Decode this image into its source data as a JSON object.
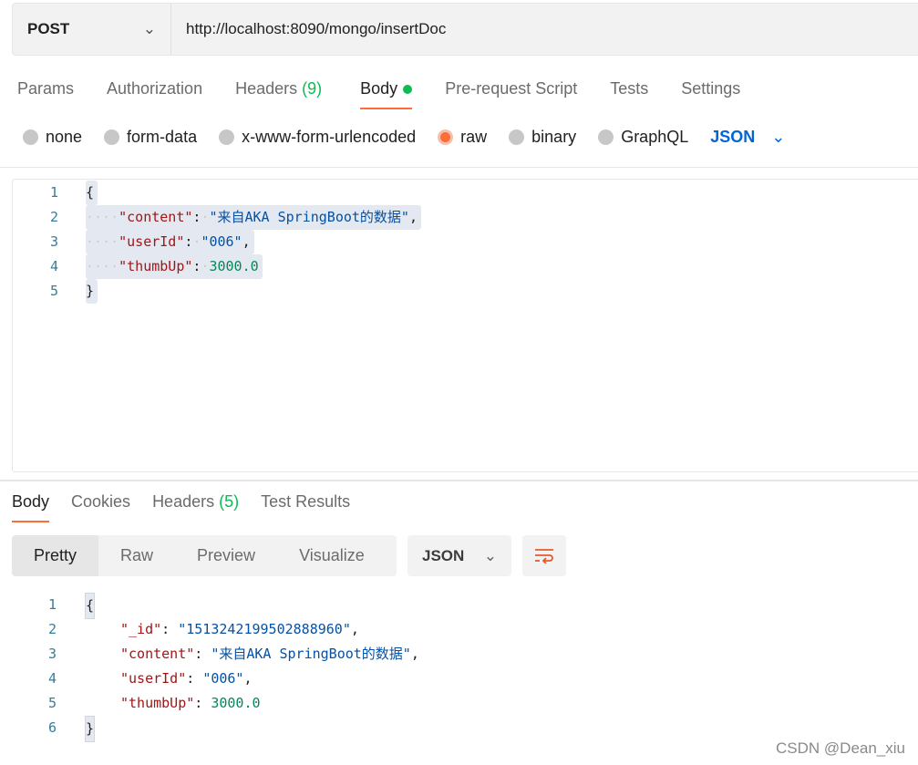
{
  "request": {
    "method": "POST",
    "url": "http://localhost:8090/mongo/insertDoc",
    "tabs": [
      {
        "label": "Params"
      },
      {
        "label": "Authorization"
      },
      {
        "label": "Headers",
        "count": "(9)"
      },
      {
        "label": "Body"
      },
      {
        "label": "Pre-request Script"
      },
      {
        "label": "Tests"
      },
      {
        "label": "Settings"
      }
    ],
    "body_types": [
      "none",
      "form-data",
      "x-www-form-urlencoded",
      "raw",
      "binary",
      "GraphQL"
    ],
    "selected_body_type": "raw",
    "format": "JSON",
    "code": [
      "{",
      "\"content\"",
      "\"来自AKA SpringBoot的数据\"",
      "\"userId\"",
      "\"006\"",
      "\"thumbUp\"",
      "3000.0",
      "}"
    ]
  },
  "response": {
    "tabs": [
      {
        "label": "Body"
      },
      {
        "label": "Cookies"
      },
      {
        "label": "Headers",
        "count": "(5)"
      },
      {
        "label": "Test Results"
      }
    ],
    "views": [
      "Pretty",
      "Raw",
      "Preview",
      "Visualize"
    ],
    "format": "JSON",
    "code": [
      "{",
      "\"_id\"",
      "\"1513242199502888960\"",
      "\"content\"",
      "\"来自AKA SpringBoot的数据\"",
      "\"userId\"",
      "\"006\"",
      "\"thumbUp\"",
      "3000.0",
      "}"
    ]
  },
  "watermark": "CSDN @Dean_xiu",
  "colors": {
    "accent": "#ff6c37",
    "green": "#0cbb52"
  }
}
